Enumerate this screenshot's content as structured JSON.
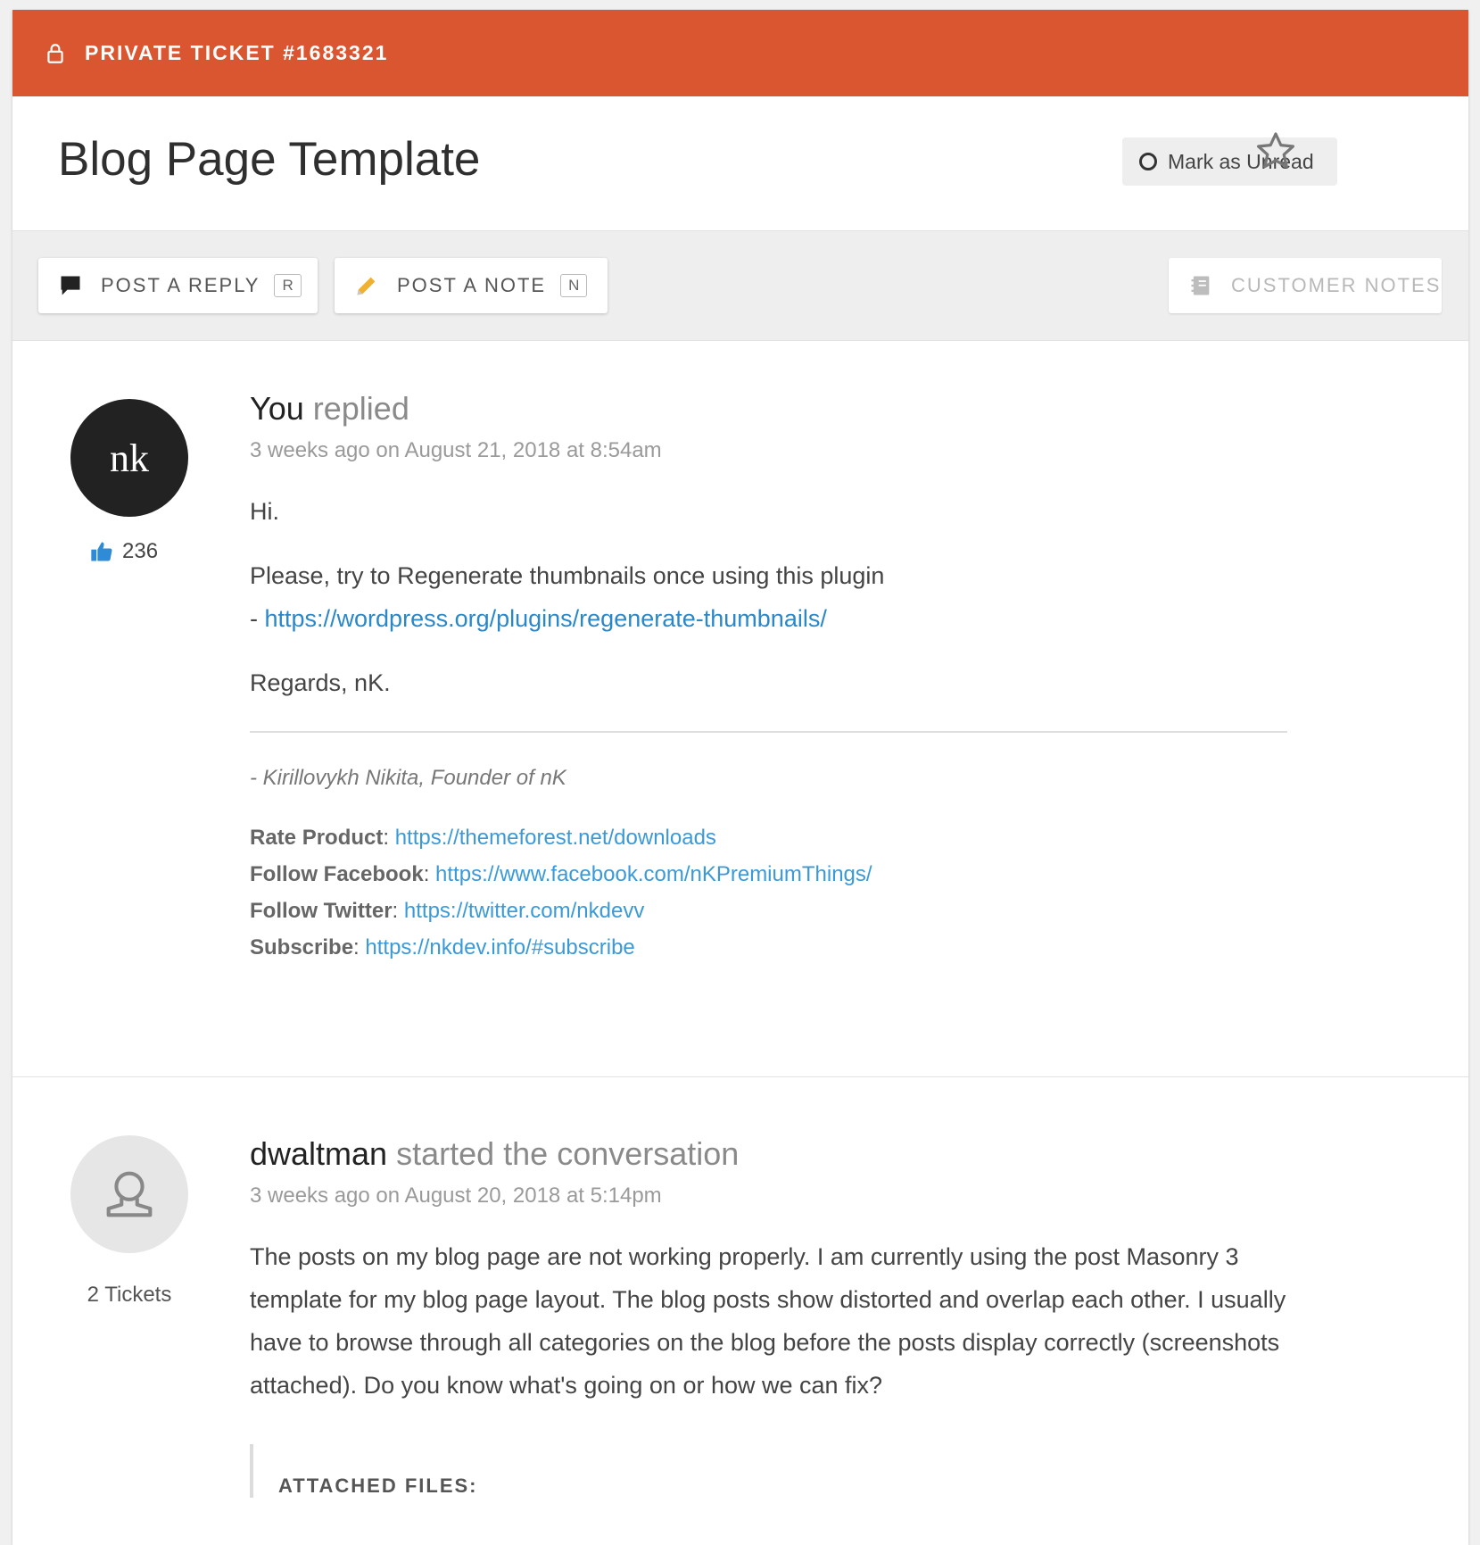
{
  "header": {
    "ticket_label": "PRIVATE TICKET #1683321",
    "title": "Blog Page Template",
    "mark_unread_label": "Mark as Unread"
  },
  "toolbar": {
    "reply_label": "POST A REPLY",
    "reply_key": "R",
    "note_label": "POST A NOTE",
    "note_key": "N",
    "customer_notes_label": "CUSTOMER NOTES"
  },
  "posts": [
    {
      "avatar_text": "nk",
      "likes": "236",
      "author": "You",
      "action": "replied",
      "timestamp": "3 weeks ago on August 21, 2018 at 8:54am",
      "greeting": "Hi.",
      "body_line1": "Please, try to Regenerate thumbnails once using this plugin",
      "body_dash": "- ",
      "body_link": "https://wordpress.org/plugins/regenerate-thumbnails/",
      "closing": "Regards, nK.",
      "signature": "- Kirillovykh Nikita, Founder of nK",
      "links": [
        {
          "label": "Rate Product",
          "url": "https://themeforest.net/downloads"
        },
        {
          "label": "Follow Facebook",
          "url": "https://www.facebook.com/nKPremiumThings/"
        },
        {
          "label": "Follow Twitter",
          "url": "https://twitter.com/nkdevv"
        },
        {
          "label": "Subscribe",
          "url": "https://nkdev.info/#subscribe"
        }
      ]
    },
    {
      "tickets": "2 Tickets",
      "author": "dwaltman",
      "action": "started the conversation",
      "timestamp": "3 weeks ago on August 20, 2018 at 5:14pm",
      "body": "The posts on my blog page are not working properly. I am currently using the post Masonry 3 template for my blog page layout. The blog posts show distorted and overlap each other. I usually have to browse through all categories on the blog before the posts display correctly (screenshots attached). Do you know what's going on or how we can fix?",
      "attached_label": "ATTACHED FILES:"
    }
  ],
  "colors": {
    "accent": "#da5630",
    "link": "#2a87c8",
    "like_icon": "#2f8bd6",
    "pencil_icon": "#f0b030"
  },
  "icons": [
    "lock-icon",
    "star-icon",
    "speech-bubble-icon",
    "pencil-icon",
    "notebook-icon",
    "thumbs-up-icon",
    "user-icon"
  ]
}
